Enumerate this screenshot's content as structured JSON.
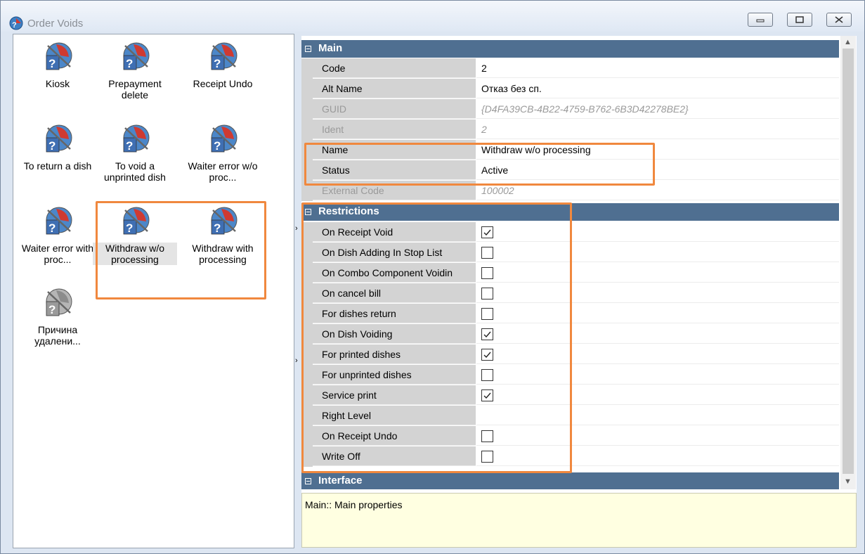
{
  "window": {
    "title": "Order Voids",
    "controls": [
      "minimize-icon",
      "maximize-icon",
      "close-icon"
    ]
  },
  "left_panel": {
    "items": [
      {
        "label": "Kiosk",
        "icon": "void-reason-icon",
        "selected": false
      },
      {
        "label": "Prepayment delete",
        "icon": "void-reason-icon",
        "selected": false
      },
      {
        "label": "Receipt Undo",
        "icon": "void-reason-icon",
        "selected": false
      },
      {
        "label": "To return a dish",
        "icon": "void-reason-icon",
        "selected": false
      },
      {
        "label": "To void a unprinted dish",
        "icon": "void-reason-icon",
        "selected": false
      },
      {
        "label": "Waiter error w/o proc...",
        "icon": "void-reason-icon",
        "selected": false
      },
      {
        "label": "Waiter error with proc...",
        "icon": "void-reason-icon",
        "selected": false
      },
      {
        "label": "Withdraw w/o processing",
        "icon": "void-reason-icon",
        "selected": true
      },
      {
        "label": "Withdraw with processing",
        "icon": "void-reason-icon",
        "selected": false
      },
      {
        "label": "Причина удалени...",
        "icon": "void-reason-disabled-icon",
        "selected": false
      }
    ]
  },
  "properties": {
    "main": {
      "title": "Main",
      "rows": [
        {
          "name": "Code",
          "value": "2",
          "disabled": false
        },
        {
          "name": "Alt Name",
          "value": "Отказ без сп.",
          "disabled": false
        },
        {
          "name": "GUID",
          "value": "{D4FA39CB-4B22-4759-B762-6B3D42278BE2}",
          "disabled": true
        },
        {
          "name": "Ident",
          "value": "2",
          "disabled": true
        },
        {
          "name": "Name",
          "value": "Withdraw w/o processing",
          "disabled": false
        },
        {
          "name": "Status",
          "value": "Active",
          "disabled": false
        },
        {
          "name": "External Code",
          "value": "100002",
          "disabled": true
        }
      ]
    },
    "restrictions": {
      "title": "Restrictions",
      "rows": [
        {
          "name": "On Receipt Void",
          "checked": true
        },
        {
          "name": "On Dish Adding In Stop List",
          "checked": false
        },
        {
          "name": "On Combo Component Voidin",
          "checked": false
        },
        {
          "name": "On cancel bill",
          "checked": false
        },
        {
          "name": "For dishes return",
          "checked": false
        },
        {
          "name": "On Dish Voiding",
          "checked": true
        },
        {
          "name": "For printed dishes",
          "checked": true
        },
        {
          "name": "For unprinted dishes",
          "checked": false
        },
        {
          "name": "Service print",
          "checked": true
        },
        {
          "name": "Right Level",
          "checked": null
        },
        {
          "name": "On Receipt Undo",
          "checked": false
        },
        {
          "name": "Write Off",
          "checked": false
        }
      ]
    },
    "interface": {
      "title": "Interface"
    }
  },
  "help_text": "Main:: Main properties",
  "colors": {
    "category_header": "#4f6f91",
    "highlight": "#f0883e",
    "help_background": "#ffffe1"
  }
}
